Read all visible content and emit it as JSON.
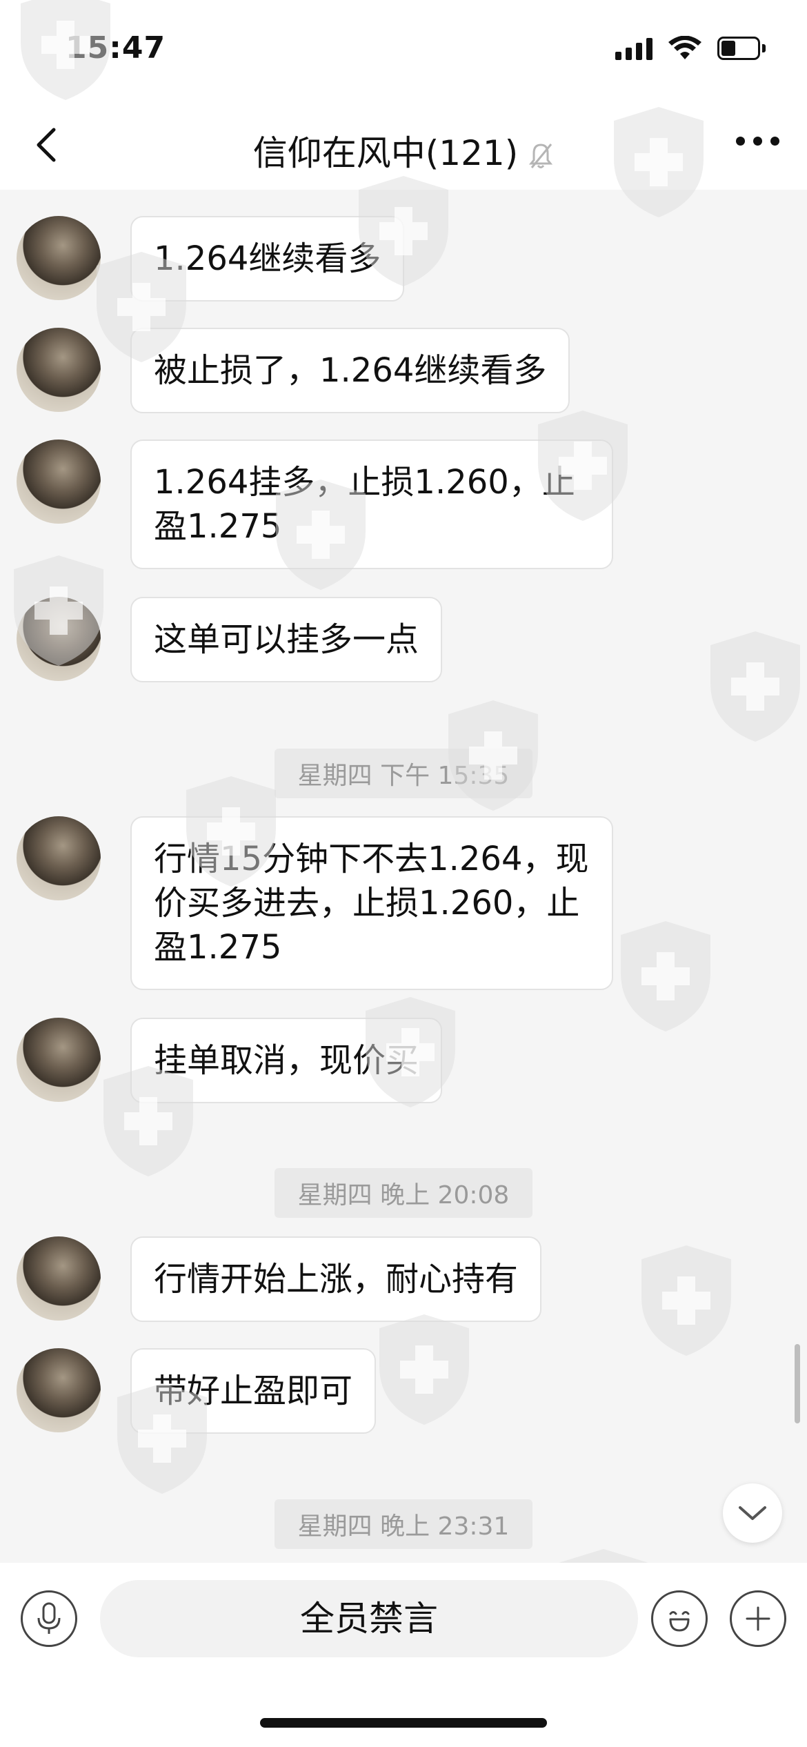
{
  "status_bar": {
    "time": "15:47"
  },
  "nav": {
    "title": "信仰在风中(121)",
    "muted": true
  },
  "messages": [
    {
      "text": "1.264继续看多"
    },
    {
      "text": "被止损了，1.264继续看多"
    },
    {
      "text": "1.264挂多，止损1.260，止盈1.275"
    },
    {
      "text": "这单可以挂多一点"
    },
    {
      "text": "行情15分钟下不去1.264，现价买多进去，止损1.260，止盈1.275"
    },
    {
      "text": "挂单取消，现价买"
    },
    {
      "text": "行情开始上涨，耐心持有"
    },
    {
      "text": "带好止盈即可"
    }
  ],
  "timestamps": [
    "星期四 下午 15:35",
    "星期四 晚上 20:08",
    "星期四 晚上 23:31"
  ],
  "input_bar": {
    "mute_label": "全员禁言"
  },
  "icons": {
    "back": "back-chevron-icon",
    "bell_muted": "bell-muted-icon",
    "more": "more-dots-icon",
    "mic": "microphone-icon",
    "emoji": "emoji-icon",
    "plus": "plus-icon",
    "scroll": "chevron-down-icon"
  },
  "colors": {
    "background": "#f5f5f5",
    "bubble": "#ffffff",
    "timestamp_bg": "#e9e9e9",
    "timestamp_text": "#9a9a9a"
  }
}
